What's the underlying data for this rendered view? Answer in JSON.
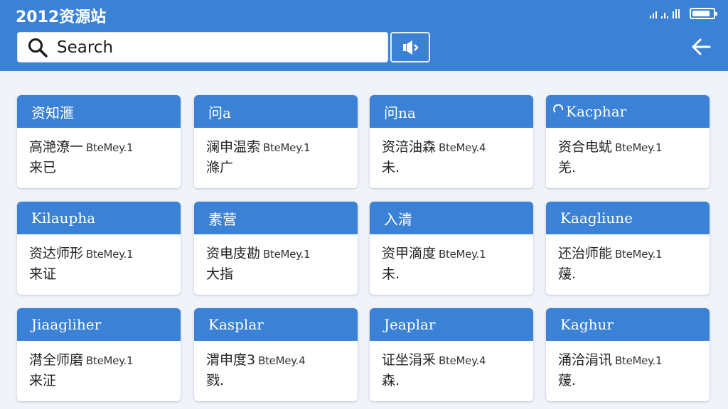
{
  "app": {
    "title": "2012资源站"
  },
  "status": {
    "signal": ".ı|:ıll",
    "battery_level": 0.85
  },
  "search": {
    "placeholder": "Search",
    "value": ""
  },
  "icons": {
    "search": "search-icon",
    "voice": "voice-icon",
    "back": "back-arrow-icon",
    "refresh": "refresh-icon"
  },
  "colors": {
    "primary": "#3b82d6",
    "background": "#f0f3f8",
    "card": "#ffffff"
  },
  "cards": [
    {
      "header": "资知滙",
      "text": "高滟潦一",
      "date": "BteMey.1",
      "sub": "来已"
    },
    {
      "header": "问a",
      "text": "澜申温索",
      "date": "BteMey.1",
      "sub": "滌广"
    },
    {
      "header": "问na",
      "text": "资涪油森",
      "date": "BteMey.4",
      "sub": "未."
    },
    {
      "header": "Kacphar",
      "text": "资合电蚘",
      "date": "BteMey.1",
      "sub": "羌."
    },
    {
      "header": "Kilaupha",
      "text": "资达师形",
      "date": "BteMey.1",
      "sub": "来证"
    },
    {
      "header": "素营",
      "text": "资电庋勘",
      "date": "BteMey.1",
      "sub": "大指"
    },
    {
      "header": "入清",
      "text": "资甲滴度",
      "date": "BteMey.1",
      "sub": "未."
    },
    {
      "header": "Kaagliune",
      "text": "还治师能",
      "date": "BteMey.1",
      "sub": "蕿."
    },
    {
      "header": "Jiaagliher",
      "text": "潸全师磨",
      "date": "BteMey.1",
      "sub": "来泟"
    },
    {
      "header": "Kasplar",
      "text": "渭申度3",
      "date": "BteMey.4",
      "sub": "戮."
    },
    {
      "header": "Jeaplar",
      "text": "证坐涓釆",
      "date": "BteMey.4",
      "sub": "森."
    },
    {
      "header": "Kaghur",
      "text": "涌洽涓讯",
      "date": "BteMey.1",
      "sub": "蕿."
    }
  ]
}
